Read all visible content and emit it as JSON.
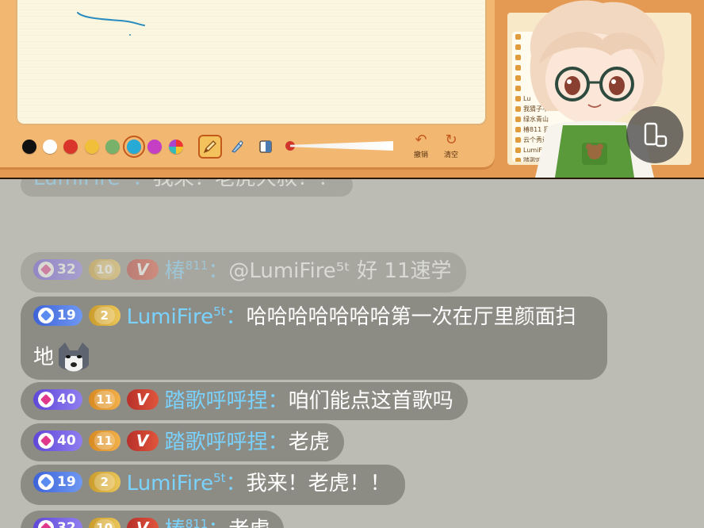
{
  "toolbar": {
    "colors": [
      "#111111",
      "#ffffff",
      "#d9352b",
      "#f2bf3a",
      "#78b26a",
      "#27aad6",
      "#c43fc4",
      "#f0a030"
    ],
    "selected_color_index": 5,
    "brush_size_fraction": 0.0,
    "undo_label": "撤销",
    "clear_label": "清空"
  },
  "side_panel": {
    "rows": [
      "",
      "",
      "",
      "",
      "",
      "",
      "Lu",
      "我猜子不",
      "绿水青山",
      "椿811 猜中",
      "云个秀边",
      "LumiFire",
      "踏歌呼呼"
    ]
  },
  "chat": {
    "messages": [
      {
        "level": "",
        "fan": "",
        "vip": false,
        "name": "LumiFire",
        "sup": "5t",
        "text": "我来！老虎大叔！！",
        "faded": true
      },
      {
        "level": "32",
        "level_style": "purple",
        "fan": "10",
        "fan_style": "gold",
        "vip": true,
        "name": "椿",
        "sup": "811",
        "text": "@LumiFire⁵ᵗ 好 11速学",
        "faded": true
      },
      {
        "level": "19",
        "level_style": "blue",
        "fan": "2",
        "fan_style": "gold",
        "vip": false,
        "name": "LumiFire",
        "sup": "5t",
        "text": "哈哈哈哈哈哈哈第一次在厅里颜面扫地",
        "emoji": "wolf-emoji"
      },
      {
        "level": "40",
        "level_style": "purple",
        "fan": "11",
        "fan_style": "orange",
        "vip": true,
        "name": "踏歌呼呼捏",
        "sup": "",
        "text": "咱们能点这首歌吗"
      },
      {
        "level": "40",
        "level_style": "purple",
        "fan": "11",
        "fan_style": "orange",
        "vip": true,
        "name": "踏歌呼呼捏",
        "sup": "",
        "text": "老虎"
      },
      {
        "level": "19",
        "level_style": "blue",
        "fan": "2",
        "fan_style": "gold",
        "vip": false,
        "name": "LumiFire",
        "sup": "5t",
        "text": "我来！老虎！！"
      },
      {
        "level": "32",
        "level_style": "purple",
        "fan": "10",
        "fan_style": "gold",
        "vip": true,
        "name": "椿",
        "sup": "811",
        "text": "老虎"
      }
    ],
    "colon": "：",
    "vip_label": "V"
  }
}
